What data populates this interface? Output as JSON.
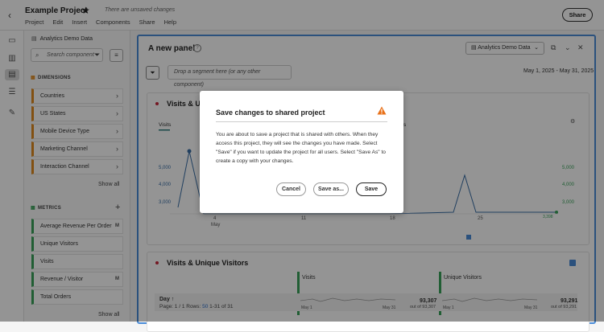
{
  "header": {
    "title": "Example Project",
    "unsaved_notice": "There are unsaved changes",
    "menu": [
      "Project",
      "Edit",
      "Insert",
      "Components",
      "Share",
      "Help"
    ],
    "share_label": "Share"
  },
  "components": {
    "data_source": "Analytics Demo Data",
    "search_placeholder": "Search component",
    "dimensions_heading": "DIMENSIONS",
    "dimensions": [
      "Countries",
      "US States",
      "Mobile Device Type",
      "Marketing Channel",
      "Interaction Channel"
    ],
    "metrics_heading": "METRICS",
    "metrics": [
      "Average Revenue Per Order",
      "Unique Visitors",
      "Visits",
      "Revenue / Visitor",
      "Total Orders"
    ],
    "metric_badges": [
      "M",
      "",
      "",
      "M",
      ""
    ],
    "show_all": "Show all"
  },
  "panel": {
    "title": "A new panel",
    "data_source": "Analytics Demo Data",
    "segment_placeholder": "Drop a segment here (or any other component)",
    "date_range": "May 1, 2025 - May 31, 2025"
  },
  "viz1": {
    "title": "Visits & Un",
    "legend_visits": "Visits",
    "legend_s": "s",
    "y_left": [
      "5,000",
      "4,000",
      "3,000"
    ],
    "y_right": [
      "5,000",
      "4,000",
      "3,000"
    ],
    "x_ticks": [
      "4",
      "11",
      "18",
      "25"
    ],
    "x_month": "May",
    "end_value": "3,398"
  },
  "viz2": {
    "title": "Visits & Unique Visitors",
    "col_visits": "Visits",
    "col_unique": "Unique Visitors",
    "day_label": "Day",
    "page_label": "Page: 1 / 1  Rows:",
    "rows_value": "50",
    "range_label": "1-31 of 31",
    "visits_total": "93,307",
    "visits_sub": "out of 93,307",
    "unique_total": "93,291",
    "unique_sub": "out of 93,291",
    "spark_start": "May 1",
    "spark_end": "May 31"
  },
  "dialog": {
    "title": "Save changes to shared project",
    "body": "You are about to save a project that is shared with others. When they access this project, they will see the changes you have made. Select \"Save\" if you want to update the project for all users. Select \"Save As\" to create a copy with your changes.",
    "cancel_label": "Cancel",
    "save_as_label": "Save as...",
    "save_label": "Save"
  },
  "colors": {
    "accent": "#4a8cd8",
    "dimension": "#e08a1e",
    "metric": "#3aa35b",
    "warning": "#e8711a"
  }
}
